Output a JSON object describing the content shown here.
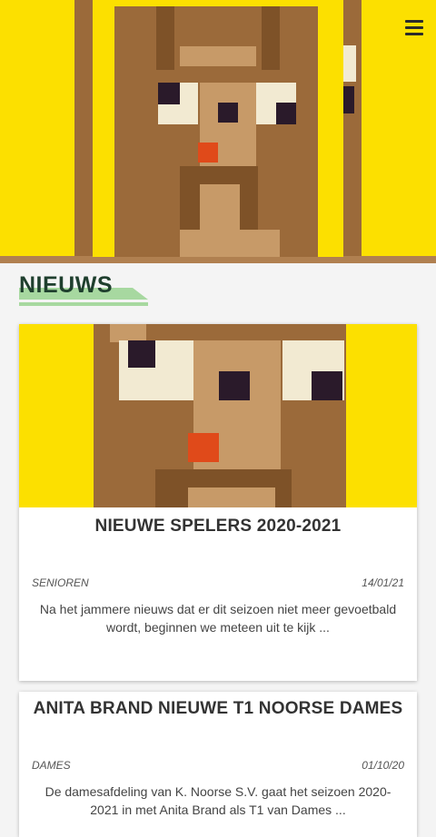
{
  "header": {
    "menu_icon": "hamburger-menu-icon",
    "logo_icon": "pixel-dog-mascot-icon",
    "brand_color": "#fce000"
  },
  "section": {
    "title": "NIEUWS"
  },
  "articles": [
    {
      "title": "NIEUWE SPELERS 2020-2021",
      "category": "SENIOREN",
      "date": "14/01/21",
      "excerpt": "Na het jammere nieuws dat er dit seizoen niet meer gevoetbald wordt, beginnen we meteen uit te kijk ..."
    },
    {
      "title": "ANITA BRAND NIEUWE T1 NOORSE DAMES",
      "category": "DAMES",
      "date": "01/10/20",
      "excerpt": "De damesafdeling van K. Noorse S.V. gaat het seizoen 2020-2021 in met Anita Brand als T1 van Dames ..."
    }
  ]
}
